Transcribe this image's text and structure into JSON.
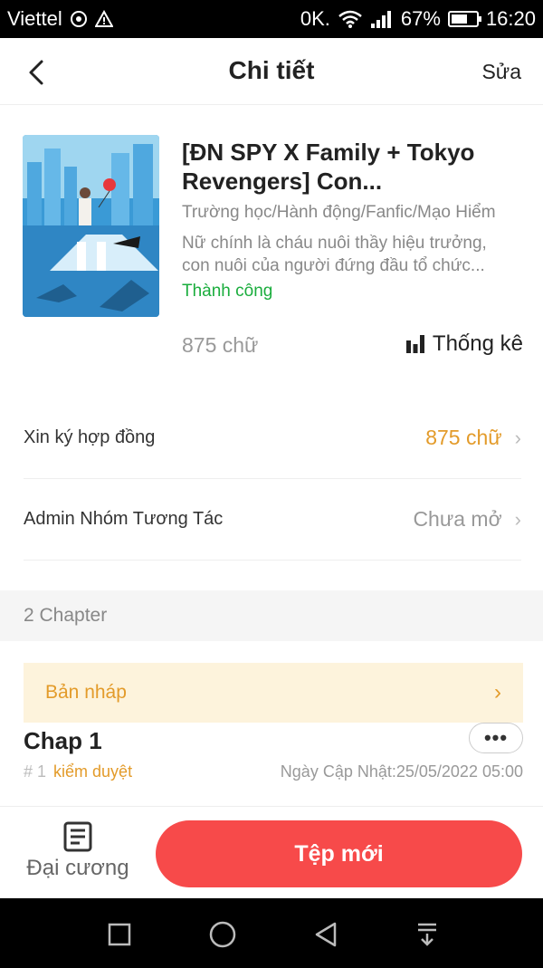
{
  "status_bar": {
    "carrier": "Viettel",
    "data_rate": "0K.",
    "battery_percent": "67%",
    "battery_level": 0.67,
    "time": "16:20"
  },
  "header": {
    "title": "Chi tiết",
    "edit_label": "Sửa"
  },
  "book": {
    "title": "[ĐN SPY X Family + Tokyo Revengers] Con...",
    "tags": "Trường học/Hành động/Fanfic/Mạo Hiểm",
    "description": "Nữ chính là cháu nuôi thầy hiệu trưởng, con nuôi của người đứng đầu tổ chức...",
    "status": "Thành công",
    "word_count": "875 chữ",
    "stats_label": "Thống kê"
  },
  "rows": [
    {
      "label": "Xin ký hợp đồng",
      "value": "875 chữ"
    },
    {
      "label": "Admin Nhóm Tương Tác",
      "value": "Chưa mở"
    }
  ],
  "chapters_header": "2 Chapter",
  "draft": {
    "label": "Bản nháp"
  },
  "chapter": {
    "title": "Chap 1",
    "number": "# 1",
    "status": "kiểm duyệt",
    "updated": "Ngày Cập Nhật:25/05/2022 05:00"
  },
  "bottom": {
    "outline_label": "Đại cương",
    "new_button_label": "Tệp mới"
  },
  "colors": {
    "accent_red": "#f74a4a",
    "accent_orange": "#e39b2a",
    "success_green": "#1aad3d"
  }
}
